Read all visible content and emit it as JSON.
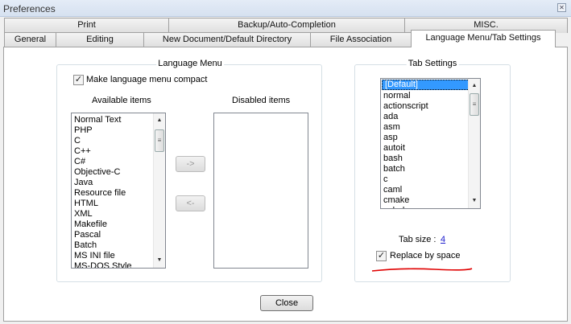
{
  "window": {
    "title": "Preferences",
    "close_icon": "close-icon"
  },
  "tabs_row1": [
    {
      "label": "Print"
    },
    {
      "label": "Backup/Auto-Completion"
    },
    {
      "label": "MISC."
    }
  ],
  "tabs_row2": [
    {
      "label": "General"
    },
    {
      "label": "Editing"
    },
    {
      "label": "New Document/Default Directory"
    },
    {
      "label": "File Association"
    },
    {
      "label": "Language Menu/Tab Settings",
      "active": true
    }
  ],
  "language_menu": {
    "title": "Language Menu",
    "compact_label": "Make language menu compact",
    "compact_checked": true,
    "available_label": "Available items",
    "available_items": [
      "Normal Text",
      "PHP",
      "C",
      "C++",
      "C#",
      "Objective-C",
      "Java",
      "Resource file",
      "HTML",
      "XML",
      "Makefile",
      "Pascal",
      "Batch",
      "MS INI file",
      "MS-DOS Style"
    ],
    "disabled_label": "Disabled items",
    "disabled_items": [],
    "move_right": "->",
    "move_left": "<-"
  },
  "tab_settings": {
    "title": "Tab Settings",
    "languages": [
      "[Default]",
      "normal",
      "actionscript",
      "ada",
      "asm",
      "asp",
      "autoit",
      "bash",
      "batch",
      "c",
      "caml",
      "cmake",
      "cobol"
    ],
    "selected": "[Default]",
    "tab_size_label": "Tab size :",
    "tab_size": "4",
    "replace_label": "Replace by space",
    "replace_checked": true
  },
  "footer": {
    "close": "Close"
  },
  "colors": {
    "selection": "#3399ff",
    "annotation": "#e00000"
  }
}
